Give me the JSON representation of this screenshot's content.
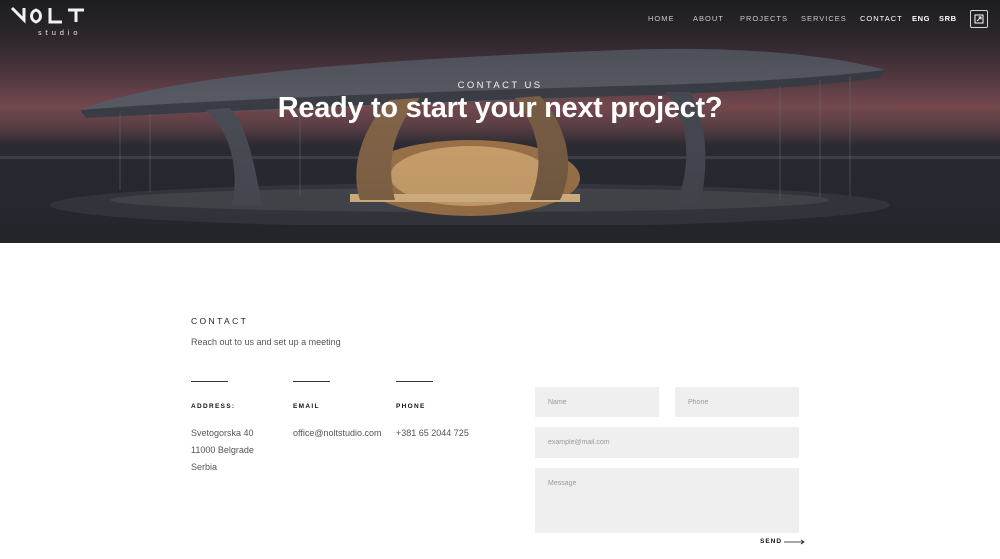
{
  "header": {
    "logo_text": "NOLT",
    "logo_sub": "studio",
    "nav": [
      {
        "label": "HOME",
        "active": false
      },
      {
        "label": "ABOUT",
        "active": false
      },
      {
        "label": "PROJECTS",
        "active": false
      },
      {
        "label": "SERVICES",
        "active": false
      },
      {
        "label": "CONTACT",
        "active": true
      }
    ],
    "languages": [
      "ENG",
      "SRB"
    ],
    "action_icon": "expand-icon"
  },
  "hero": {
    "kicker": "CONTACT US",
    "title": "Ready to start your next project?"
  },
  "contact": {
    "kicker": "CONTACT",
    "subtitle": "Reach out to us and set up a meeting",
    "address": {
      "label": "ADDRESS:",
      "lines": [
        "Svetogorska 40",
        "11000 Belgrade",
        "Serbia"
      ]
    },
    "email": {
      "label": "EMAIL",
      "value": "office@noltstudio.com"
    },
    "phone": {
      "label": "PHONE",
      "value": "+381 65 2044 725"
    }
  },
  "form": {
    "name_placeholder": "Name",
    "phone_placeholder": "Phone",
    "email_placeholder": "example@mail.com",
    "message_placeholder": "Message",
    "send_label": "SEND"
  },
  "colors": {
    "accent": "#111111",
    "field_bg": "#efefef",
    "hero_dark": "#2a2c33",
    "hero_sunset": "#7a4c52"
  }
}
